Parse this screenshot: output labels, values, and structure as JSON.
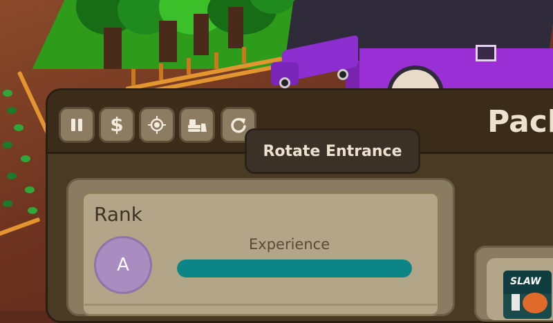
{
  "toolbar": {
    "buttons": [
      {
        "icon": "pause-icon",
        "label": "Pause"
      },
      {
        "icon": "dollar-icon",
        "label": "$"
      },
      {
        "icon": "target-icon",
        "label": "Locate"
      },
      {
        "icon": "bulldozer-icon",
        "label": "Demolish"
      },
      {
        "icon": "rotate-icon",
        "label": "Rotate Entrance"
      }
    ],
    "dollar_symbol": "$"
  },
  "tooltip": {
    "text": "Rotate Entrance"
  },
  "panel": {
    "title": "Pack"
  },
  "rank": {
    "label": "Rank",
    "value": "A"
  },
  "experience": {
    "label": "Experience",
    "progress": 1.0
  },
  "item_card": {
    "name": "SLAW"
  },
  "colors": {
    "panel_bg": "#4a3a24",
    "header_bg": "#3a2c18",
    "button_bg": "#8c7c62",
    "card_bg": "#b3a587",
    "rank_badge": "#a98cc0",
    "exp_fill": "#0b8585",
    "building_purple": "#9a2fd6"
  }
}
